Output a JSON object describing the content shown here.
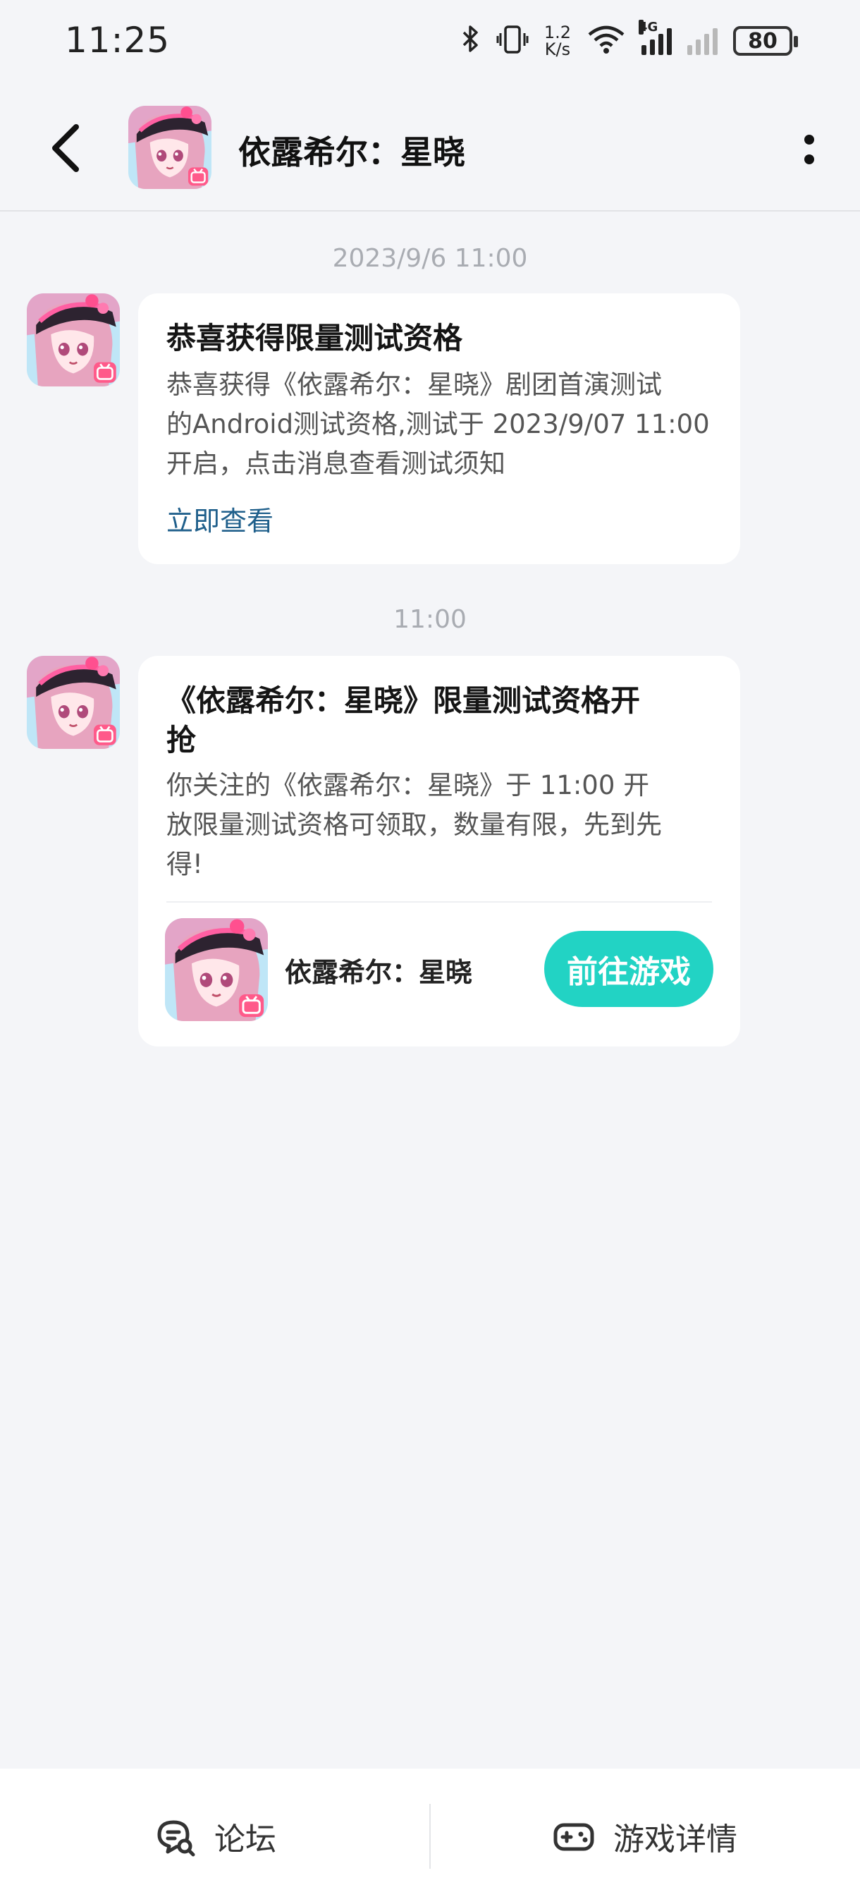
{
  "status_bar": {
    "time": "11:25",
    "network_speed_value": "1.2",
    "network_speed_unit": "K/s",
    "signal_label": "4G",
    "battery": "80",
    "icons": [
      "bluetooth-icon",
      "vibrate-icon",
      "wifi-icon",
      "signal-icon",
      "signal-off-icon",
      "battery-icon"
    ]
  },
  "header": {
    "title": "依露希尔：星晓",
    "back_icon": "chevron-left-icon",
    "more_icon": "more-vertical-icon"
  },
  "messages": [
    {
      "timestamp": "2023/9/6  11:00",
      "title": "恭喜获得限量测试资格",
      "body_lines": [
        "恭喜获得《依露希尔：星晓》剧团首演测试",
        "的Android测试资格,测试于 2023/9/07 11:00",
        "开启，点击消息查看测试须知"
      ],
      "link": "立即查看"
    },
    {
      "timestamp": "11:00",
      "title_lines": [
        "《依露希尔：星晓》限量测试资格开",
        "抢"
      ],
      "body_lines": [
        "你关注的《依露希尔：星晓》于 11:00 开",
        "放限量测试资格可领取，数量有限，先到先",
        "得!"
      ],
      "game_name": "依露希尔：星晓",
      "button": "前往游戏"
    }
  ],
  "bottom_bar": {
    "tabs": [
      {
        "label": "论坛",
        "icon": "forum-chat-icon"
      },
      {
        "label": "游戏详情",
        "icon": "gamepad-icon"
      }
    ]
  },
  "colors": {
    "background": "#f4f5f8",
    "accent_button": "#22d3c4",
    "link": "#1f5f8b",
    "timestamp": "#a9acb2"
  }
}
